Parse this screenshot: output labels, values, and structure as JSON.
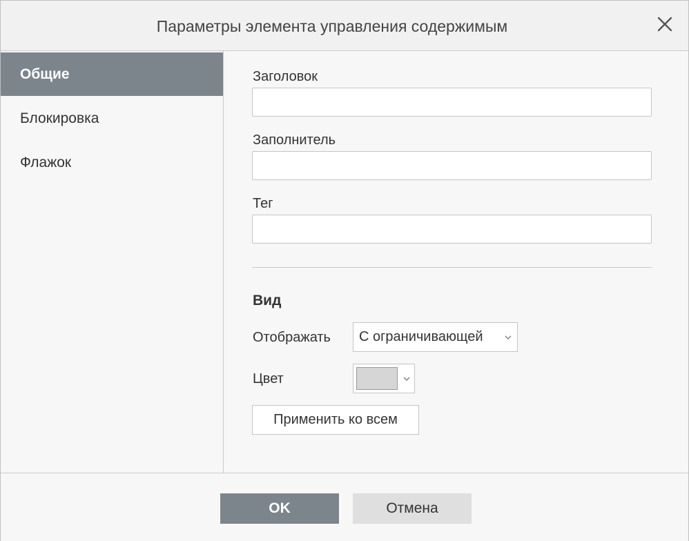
{
  "dialog": {
    "title": "Параметры элемента управления содержимым",
    "close_icon": "close-icon"
  },
  "sidebar": {
    "items": [
      {
        "label": "Общие",
        "active": true
      },
      {
        "label": "Блокировка",
        "active": false
      },
      {
        "label": "Флажок",
        "active": false
      }
    ]
  },
  "general": {
    "title_label": "Заголовок",
    "title_value": "",
    "placeholder_label": "Заполнитель",
    "placeholder_value": "",
    "tag_label": "Тег",
    "tag_value": ""
  },
  "appearance": {
    "section_title": "Вид",
    "display_label": "Отображать",
    "display_value": "С ограничивающей",
    "color_label": "Цвет",
    "color_value": "#d6d6d6",
    "apply_all_label": "Применить ко всем"
  },
  "footer": {
    "ok_label": "OK",
    "cancel_label": "Отмена"
  },
  "colors": {
    "accent": "#7d858c",
    "background": "#f7f7f7",
    "border": "#c4c4c4"
  }
}
